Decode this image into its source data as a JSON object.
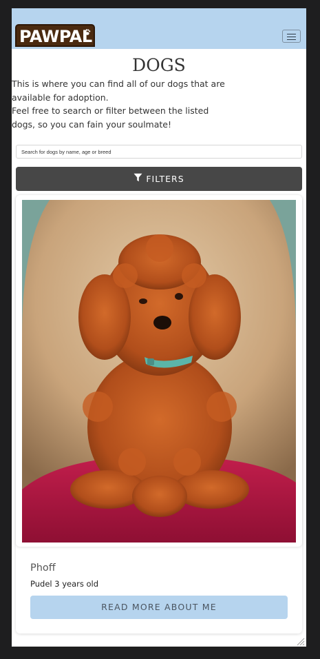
{
  "brand": {
    "logo_text": "PAWPAL",
    "logo_icon": "paw-icon"
  },
  "nav": {
    "menu_icon": "hamburger-menu-icon"
  },
  "page": {
    "title": "DOGS",
    "intro_line1": "This is where you can find all of our dogs that are available for adoption.",
    "intro_line2": "Feel free to search or filter between the listed dogs, so you can fain your soulmate!"
  },
  "search": {
    "placeholder": "Search for dogs by name, age or breed",
    "value": ""
  },
  "filters": {
    "label": "FILTERS",
    "icon": "filter-funnel-icon"
  },
  "dogs": [
    {
      "name": "Phoff",
      "details": "Pudel 3 years old",
      "cta_label": "READ MORE ABOUT ME"
    }
  ],
  "colors": {
    "navbar": "#b6d4ee",
    "filters_button": "#474747",
    "cta_button": "#b6d4ee",
    "logo_bg": "#4a2a10"
  }
}
